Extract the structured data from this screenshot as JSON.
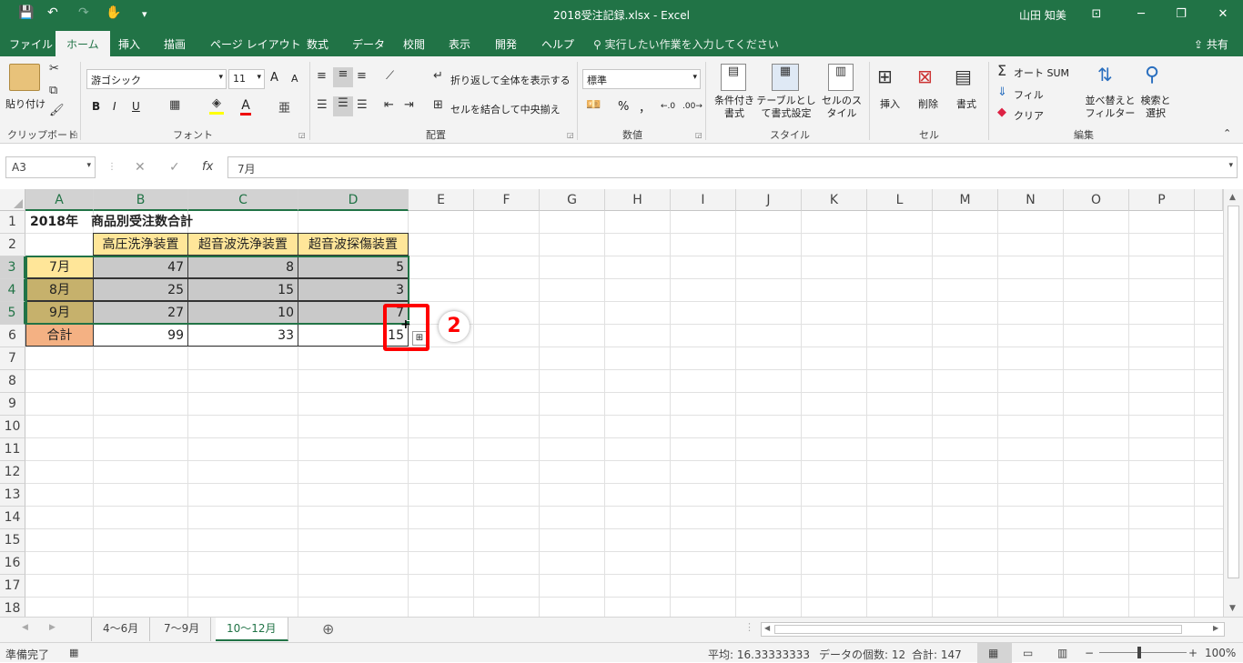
{
  "window": {
    "title": "2018受注記録.xlsx  -  Excel",
    "user": "山田 知美",
    "minimize": "─",
    "restore": "❐",
    "close": "✕",
    "ribbon_display": "⊡"
  },
  "qat": {
    "save_icon": "💾",
    "undo_icon": "↶",
    "redo_icon": "↷",
    "touch_icon": "✋",
    "customize_icon": "▾"
  },
  "menu": {
    "tabs": [
      "ファイル",
      "ホーム",
      "挿入",
      "描画",
      "ページ レイアウト",
      "数式",
      "データ",
      "校閲",
      "表示",
      "開発",
      "ヘルプ"
    ],
    "active_tab": "ホーム",
    "search_placeholder": "実行したい作業を入力してください",
    "share": "共有"
  },
  "ribbon": {
    "clipboard": {
      "paste": "貼り付け",
      "group": "クリップボード"
    },
    "font": {
      "name": "游ゴシック",
      "size": "11",
      "bold": "B",
      "italic": "I",
      "underline": "U",
      "grow": "A",
      "shrink": "A",
      "font_color": "A",
      "group": "フォント"
    },
    "alignment": {
      "wrap": "折り返して全体を表示する",
      "merge": "セルを結合して中央揃え",
      "group": "配置"
    },
    "number": {
      "format": "標準",
      "percent": "%",
      "comma": "，",
      "inc_decimal": "←.0",
      "dec_decimal": ".00→",
      "group": "数値"
    },
    "styles": {
      "conditional": "条件付き書式",
      "table": "テーブルとして書式設定",
      "cell": "セルのスタイル",
      "group": "スタイル"
    },
    "cells": {
      "insert": "挿入",
      "delete": "削除",
      "format": "書式",
      "group": "セル"
    },
    "editing": {
      "autosum": "オート SUM",
      "fill": "フィル",
      "clear": "クリア",
      "sort": "並べ替えとフィルター",
      "find": "検索と選択",
      "group": "編集"
    }
  },
  "formula_bar": {
    "name_box": "A3",
    "cancel": "✕",
    "enter": "✓",
    "fx": "fx",
    "value": "7月"
  },
  "sheet": {
    "columns": [
      "A",
      "B",
      "C",
      "D",
      "E",
      "F",
      "G",
      "H",
      "I",
      "J",
      "K",
      "L",
      "M",
      "N",
      "O",
      "P"
    ],
    "rows": [
      "1",
      "2",
      "3",
      "4",
      "5",
      "6",
      "7",
      "8",
      "9",
      "10",
      "11",
      "12",
      "13",
      "14",
      "15",
      "16",
      "17",
      "18"
    ],
    "title": "2018年　商品別受注数合計",
    "headers": [
      "高圧洗浄装置",
      "超音波洗浄装置",
      "超音波探傷装置"
    ],
    "data_rows": [
      {
        "label": "7月",
        "values": [
          "47",
          "8",
          "5"
        ]
      },
      {
        "label": "8月",
        "values": [
          "25",
          "15",
          "3"
        ]
      },
      {
        "label": "9月",
        "values": [
          "27",
          "10",
          "7"
        ]
      }
    ],
    "total": {
      "label": "合計",
      "values": [
        "99",
        "33",
        "15"
      ]
    },
    "callout": "2"
  },
  "sheet_tabs": {
    "tabs": [
      "4～6月",
      "7～9月",
      "10～12月"
    ],
    "active": "10～12月",
    "add": "⊕"
  },
  "status": {
    "ready": "準備完了",
    "average": "平均: 16.33333333",
    "count": "データの個数: 12",
    "sum": "合計: 147",
    "zoom": "100%"
  },
  "colors": {
    "brand": "#217346",
    "header_fill": "#FFE699",
    "month_fill_1": "#FFE699",
    "month_fill_2": "#C6B16C",
    "total_fill": "#F4B183",
    "highlight": "#FF0000"
  }
}
